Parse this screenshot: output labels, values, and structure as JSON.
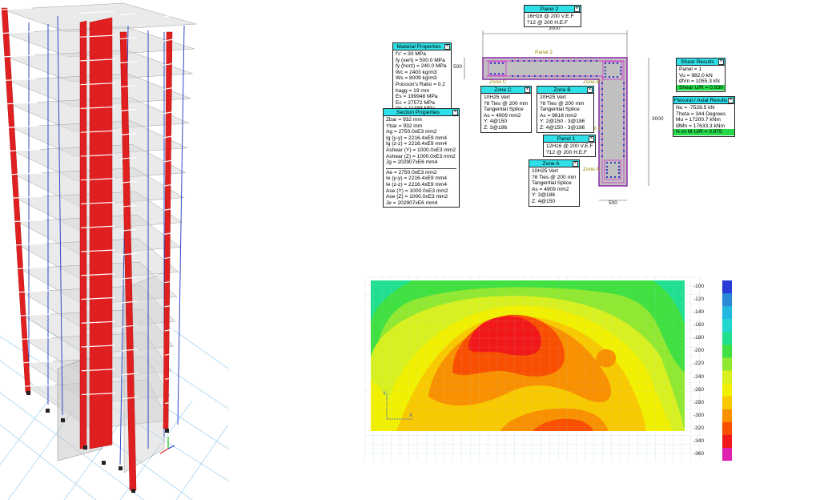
{
  "panel2_box": {
    "title": "Panel 2",
    "rows": [
      "16H16 @ 200 V.E.F",
      "?12 @ 200 H.E.F"
    ]
  },
  "material_box": {
    "title": "Material Properties",
    "rows": [
      "f'c' = 30 MPa",
      "fy (vert) = 500.0 MPa",
      "fy (horz) = 240.0 MPa",
      "Wc = 2403 kg/m3",
      "Ws = 8009 kg/m3",
      "Poisson's Ratio = 0.2",
      "hagg = 19 mm",
      "Es = 199948 MPa",
      "Ec = 27572 MPa",
      "Gc = 11488 MPa"
    ]
  },
  "section_box": {
    "title": "Section Properties",
    "rows": [
      "Zbar = 932 mm",
      "Ybar = 932 mm",
      "Ag = 2750.0xE3 mm2",
      "Ig (y-y) = 2216.4xE9 mm4",
      "Ig (z-z) = 2216.4xE9 mm4",
      "Ashear (Y) = 1000.0xE3 mm2",
      "Ashear (Z) = 1000.0xE3 mm2",
      "Jg = 202907xE6 mm4"
    ],
    "rows2": [
      "Ae = 2750.0xE3 mm2",
      "Ie (y-y) = 2216.4xE9 mm4",
      "Ie (z-z) = 2216.4xE9 mm4",
      "Ase (Y) = 1000.0xE3 mm2",
      "Ase (Z) = 1000.0xE3 mm2",
      "Je = 202907xE6 mm4"
    ]
  },
  "zone_c_box": {
    "title": "Zone C",
    "rows": [
      "10H25 Vert",
      "?8 Ties @ 200 mm",
      "Tangential Splice",
      "As = 4909 mm2",
      "Y: 4@150",
      "Z: 3@186"
    ]
  },
  "zone_b_box": {
    "title": "Zone B",
    "rows": [
      "20H25 Vert",
      "?8 Ties @ 200 mm",
      "Tangential Splice",
      "As = 9818 mm2",
      "Y: 2@150 - 3@186",
      "Z: 4@150 - 3@186"
    ]
  },
  "panel1_box": {
    "title": "Panel 1",
    "rows": [
      "12H16 @ 200 V.E.F",
      "?12 @ 200 H.E.F"
    ]
  },
  "zone_a_box": {
    "title": "Zone A",
    "rows": [
      "10H25 Vert",
      "?8 Ties @ 200 mm",
      "Tangential Splice",
      "As = 4909 mm2",
      "Y: 3@186",
      "Z: 4@150"
    ]
  },
  "shear_box": {
    "title": "Shear Results",
    "rows": [
      "Panel = 1",
      "Vu = 982.0 kN",
      "ØVn = 1055.3 kN"
    ],
    "status": "Shear U/R = 0.930"
  },
  "flexural_box": {
    "title": "Flexural / Axial Results",
    "rows": [
      "Nu = -7528.5 kN",
      "Theta = 344 Degrees",
      "Mu = 17200.7 kNm",
      "ØMn = 17633.3 kNm"
    ],
    "status": "N vs M U/R = 0.975"
  },
  "section_labels": {
    "dim_top": "3000",
    "dim_left": "500",
    "dim_right": "3000",
    "dim_bottom": "500",
    "panel2": "Panel 2",
    "panel1": "Panel 1",
    "zone_c": "Zone C",
    "zone_b": "Zone B",
    "zone_a": "Zone A"
  },
  "color_scale": {
    "ticks": [
      "-100",
      "-120",
      "-140",
      "-160",
      "-180",
      "-200",
      "-220",
      "-240",
      "-260",
      "-280",
      "-300",
      "-320",
      "-340",
      "-360"
    ],
    "colors": [
      "#2a3cd8",
      "#2a8ad8",
      "#22b8e0",
      "#20d8d0",
      "#20e090",
      "#40e040",
      "#90e830",
      "#d8f020",
      "#f0f000",
      "#f8c800",
      "#f89000",
      "#f85000",
      "#f01818",
      "#e020b0"
    ]
  },
  "colors": {
    "header": "#2fe0e8",
    "ok": "#26d94a",
    "column": "#e02020",
    "wall": "#c8c8c8"
  },
  "axis_labels": {
    "y": "Y",
    "x": "X"
  }
}
